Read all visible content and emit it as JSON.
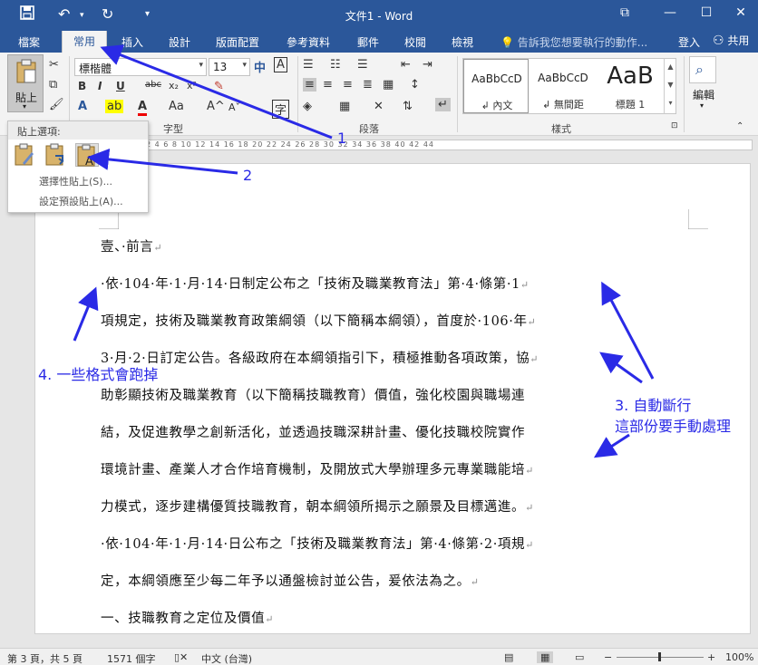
{
  "titlebar": {
    "title": "文件1 - Word",
    "save_icon": "save-icon",
    "undo_icon": "undo-icon",
    "redo_icon": "redo-icon"
  },
  "tabs": {
    "items": [
      "檔案",
      "常用",
      "插入",
      "設計",
      "版面配置",
      "參考資料",
      "郵件",
      "校閱",
      "檢視"
    ],
    "tellme": "告訴我您想要執行的動作...",
    "signin": "登入",
    "share": "共用"
  },
  "ribbon": {
    "paste_label": "貼上",
    "font_name": "標楷體",
    "font_size": "13",
    "groups": {
      "font": "字型",
      "paragraph": "段落",
      "styles": "樣式",
      "editing": "編輯"
    },
    "styles": [
      {
        "sample": "AaBbCcD",
        "name": "↲ 內文"
      },
      {
        "sample": "AaBbCcD",
        "name": "↲ 無間距"
      },
      {
        "sample": "AaB",
        "name": "標題 1"
      }
    ],
    "accent": "#2b579a"
  },
  "ruler": {
    "marks": "2 4 6 8 10 12 14 16 18 20 22 24 26 28 30 32 34 36 38 40 42 44"
  },
  "paste_menu": {
    "header": "貼上選項:",
    "items": [
      "選擇性貼上(S)...",
      "設定預設貼上(A)..."
    ]
  },
  "document": {
    "lines": [
      "壹、·前言",
      "·依·104·年·1·月·14·日制定公布之「技術及職業教育法」第·4·條第·1",
      "項規定，技術及職業教育政策綱領（以下簡稱本綱領），首度於·106·年",
      "3·月·2·日訂定公告。各級政府在本綱領指引下，積極推動各項政策，協",
      "助彰顯技術及職業教育（以下簡稱技職教育）價值，強化校園與職場連",
      "結，及促進教學之創新活化，並透過技職深耕計畫、優化技職校院實作",
      "環境計畫、產業人才合作培育機制，及開放式大學辦理多元專業職能培",
      "力模式，逐步建構優質技職教育，朝本綱領所揭示之願景及目標邁進。",
      "·依·104·年·1·月·14·日公布之「技術及職業教育法」第·4·條第·2·項規",
      "定，本綱領應至少每二年予以通盤檢討並公告，爰依法為之。",
      "一、技職教育之定位及價值"
    ],
    "paragraph_marks": [
      "↵",
      "↵",
      "↵",
      "↵",
      "",
      "",
      "↵",
      "↵",
      "↵",
      "↵",
      "↵"
    ]
  },
  "annotations": {
    "a1": "1",
    "a2": "2",
    "a3_line1": "3. 自動斷行",
    "a3_line2": "這部份要手動處理",
    "a4": "4. 一些格式會跑掉",
    "color": "#2a2ae6"
  },
  "status": {
    "page": "第 3 頁，共 5 頁",
    "words": "1571 個字",
    "language": "中文 (台灣)",
    "zoom": "100%"
  }
}
